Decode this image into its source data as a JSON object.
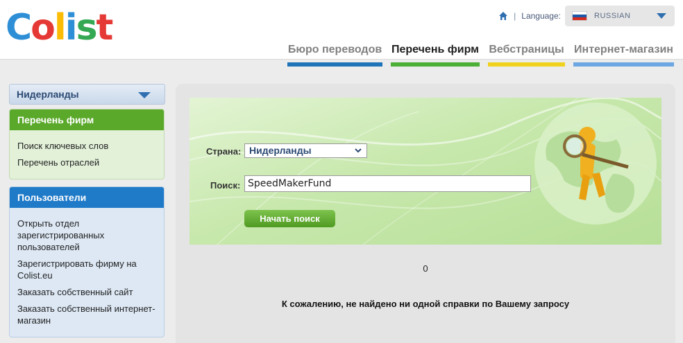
{
  "logo": {
    "letters": [
      "C",
      "o",
      "l",
      "i",
      "s",
      "t"
    ],
    "colors": [
      "#2f8fd6",
      "#e53935",
      "#fbbc05",
      "#2f8fd6",
      "#34a853",
      "#e53935"
    ]
  },
  "top": {
    "home_icon": "home-icon",
    "separator": "|",
    "language_label": "Language:",
    "language_value": "RUSSIAN",
    "flag_colors": [
      "#ffffff",
      "#1c57a8",
      "#d52b1e"
    ]
  },
  "nav": [
    {
      "label": "Бюро переводов",
      "color": "#1f73b8",
      "active": false
    },
    {
      "label": "Перечень фирм",
      "color": "#4caf36",
      "active": true
    },
    {
      "label": "Вебстраницы",
      "color": "#f0d21e",
      "active": false
    },
    {
      "label": "Интернет-магазин",
      "color": "#6ca7e3",
      "active": false
    }
  ],
  "sidebar": {
    "country": "Нидерланды",
    "firms": {
      "title": "Перечень фирм",
      "links": [
        "Поиск ключевых слов",
        "Перечень отраслей"
      ]
    },
    "users": {
      "title": "Пользователи",
      "links": [
        "Открыть отдел зарегистрированных пользователей",
        "Зарегистрировать фирму на Colist.eu",
        "Заказать собственный сайт",
        "Заказать собственный интернет-магазин"
      ]
    }
  },
  "search": {
    "country_label": "Страна:",
    "country_value": "Нидерланды",
    "query_label": "Поиск:",
    "query_value": "SpeedMakerFund",
    "button": "Начать поиск"
  },
  "results": {
    "count": "0",
    "message": "К сожалению, не найдено ни одной справки по Вашему запросу"
  }
}
